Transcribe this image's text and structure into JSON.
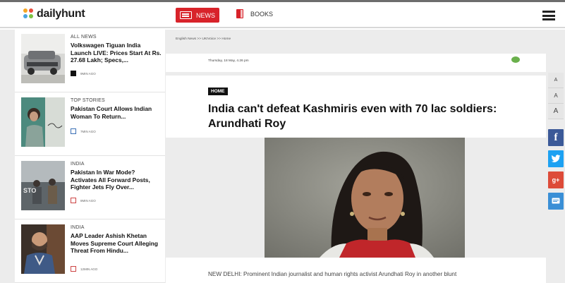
{
  "header": {
    "logo_text": "dailyhunt",
    "nav_news_label": "NEWS",
    "nav_books_label": "BOOKS",
    "brand_color": "#d8232a"
  },
  "sidebar": {
    "items": [
      {
        "category": "ALL NEWS",
        "title": "Volkswagen Tiguan India Launch LIVE: Prices Start At Rs. 27.68 Lakh; Specs,...",
        "time": "9MIN AGO"
      },
      {
        "category": "TOP STORIES",
        "title": "Pakistan Court Allows Indian Woman To Return...",
        "time": "7MIN AGO"
      },
      {
        "category": "INDIA",
        "title": "Pakistan In War Mode? Activates All Forward Posts, Fighter Jets Fly Over...",
        "time": "8MIN AGO"
      },
      {
        "category": "INDIA",
        "title": "AAP Leader Ashish Khetan Moves Supreme Court Alleging Threat From Hindu...",
        "time": "12MIN AGO"
      }
    ]
  },
  "article": {
    "breadcrumb": "English News >> UKIVoice >> Home",
    "date": "Thursday, 18 May, 4.26 pm",
    "tag": "HOME",
    "headline": "India can't defeat Kashmiris even with 70 lac soldiers: Arundhati Roy",
    "body_preview": "NEW DELHI: Prominent Indian journalist and human rights activist Arundhati Roy in another blunt"
  },
  "tools": {
    "font_small": "A",
    "font_medium": "A",
    "font_large": "A",
    "share_icons": [
      "facebook-icon",
      "twitter-icon",
      "google-plus-icon",
      "message-icon"
    ],
    "share_colors": [
      "#3b5998",
      "#1da1f2",
      "#dd4b39",
      "#3a8fd6"
    ]
  }
}
